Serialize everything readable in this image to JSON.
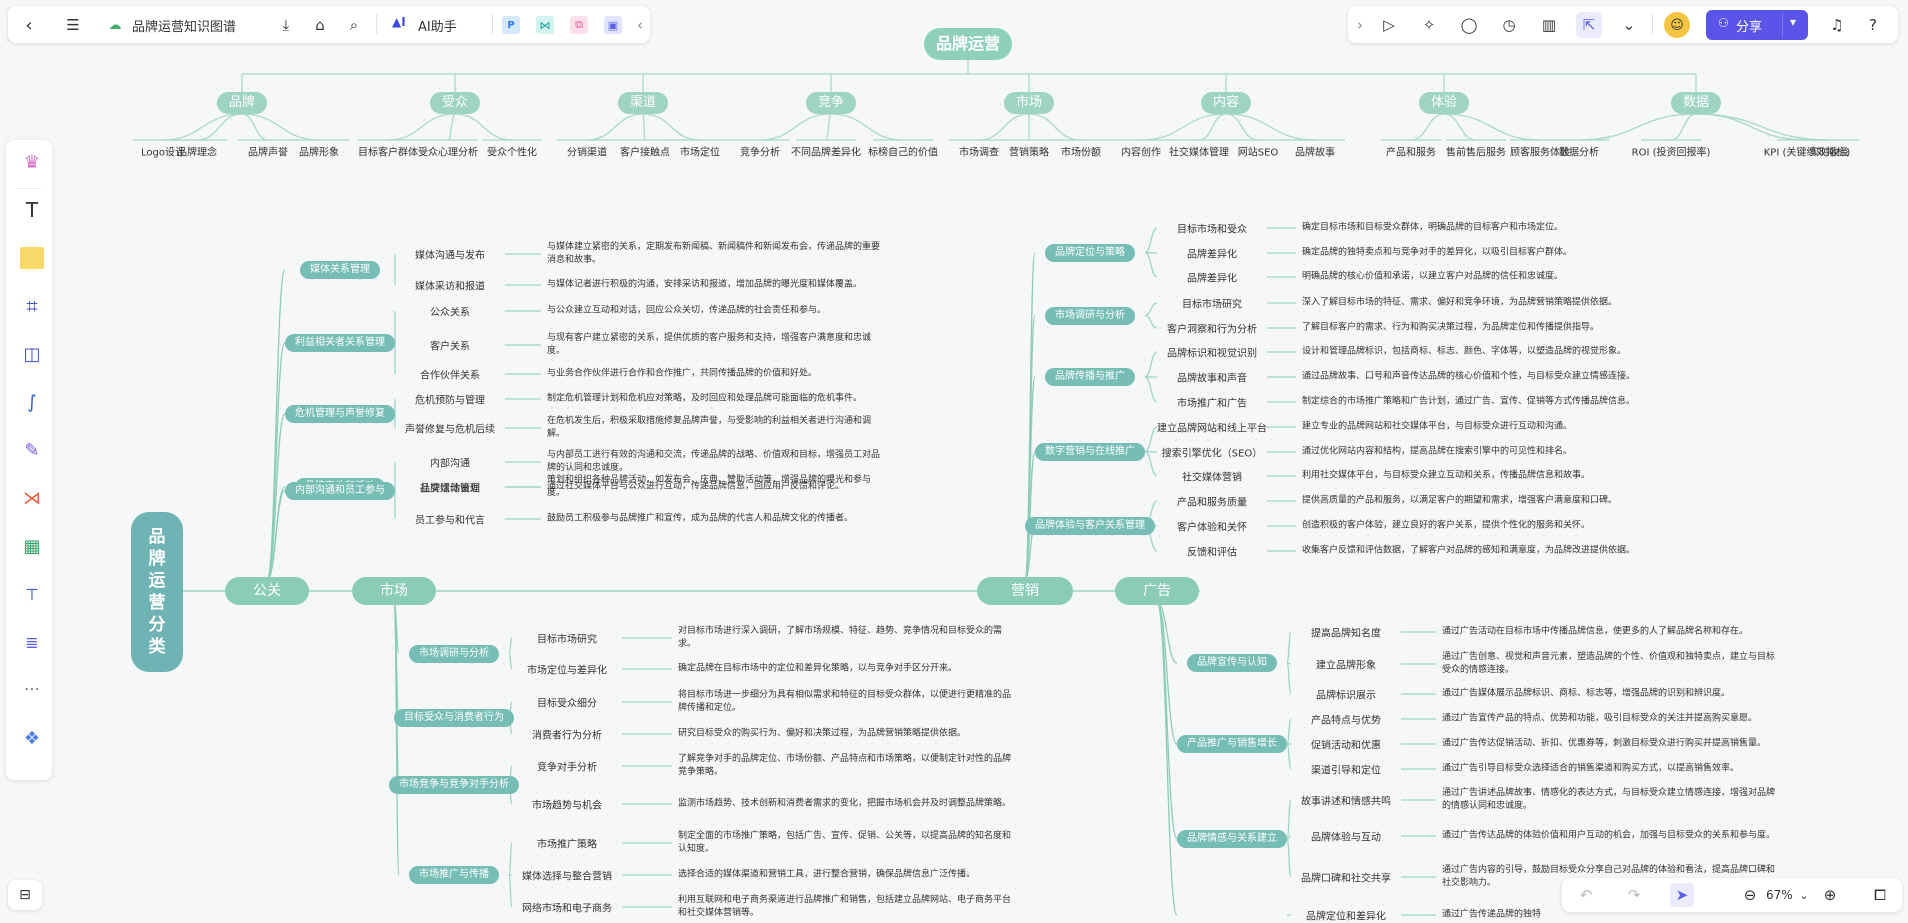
{
  "doc_title": "品牌运营知识图谱",
  "ai_label": "AI助手",
  "share_label": "分享",
  "zoom": "67%",
  "top_map": {
    "root": "品牌运营",
    "branches": [
      {
        "label": "品牌",
        "children": [
          "Logo设计",
          "品牌理念",
          "品牌声誉",
          "品牌形象"
        ]
      },
      {
        "label": "受众",
        "children": [
          "目标客户群体",
          "受众心理分析",
          "受众个性化"
        ]
      },
      {
        "label": "渠道",
        "children": [
          "分销渠道",
          "客户接触点",
          "市场定位"
        ]
      },
      {
        "label": "竞争",
        "children": [
          "竞争分析",
          "不同品牌差异化",
          "标榜自己的价值"
        ]
      },
      {
        "label": "市场",
        "children": [
          "市场调查",
          "营销策略",
          "市场份额"
        ]
      },
      {
        "label": "内容",
        "children": [
          "内容创作",
          "社交媒体管理",
          "网站SEO",
          "品牌故事"
        ]
      },
      {
        "label": "体验",
        "children": [
          "产品和服务",
          "售前售后服务",
          "顾客服务体验"
        ]
      },
      {
        "label": "数据",
        "children": [
          "数据分析",
          "ROI (投资回报率)",
          "KPI (关键绩效指标)",
          "实时收益"
        ]
      }
    ]
  },
  "main_map": {
    "root": "品牌运营分类",
    "main_nodes": [
      "公关",
      "市场",
      "营销",
      "广告"
    ],
    "pr": [
      {
        "label": "媒体关系管理",
        "items": [
          {
            "name": "媒体沟通与发布",
            "desc": "与媒体建立紧密的关系，定期发布新闻稿、新闻稿件和新闻发布会，传递品牌的重要消息和故事。"
          },
          {
            "name": "媒体采访和报道",
            "desc": "与媒体记者进行积极的沟通，安排采访和报道，增加品牌的曝光度和媒体覆盖。"
          }
        ]
      },
      {
        "label": "利益相关者关系管理",
        "items": [
          {
            "name": "公众关系",
            "desc": "与公众建立互动和对话，回应公众关切，传递品牌的社会责任和参与。"
          },
          {
            "name": "客户关系",
            "desc": "与现有客户建立紧密的关系，提供优质的客户服务和支持，增强客户满意度和忠诚度。"
          },
          {
            "name": "合作伙伴关系",
            "desc": "与业务合作伙伴进行合作和合作推广，共同传播品牌的价值和好处。"
          }
        ]
      },
      {
        "label": "危机管理与声誉修复",
        "items": [
          {
            "name": "危机预防与管理",
            "desc": "制定危机管理计划和危机应对策略，及时回应和处理品牌可能面临的危机事件。"
          },
          {
            "name": "声誉修复与危机后续",
            "desc": "在危机发生后，积极采取措施修复品牌声誉，与受影响的利益相关者进行沟通和调解。"
          }
        ]
      },
      {
        "label": "品牌事件和活动",
        "items": [
          {
            "name": "品牌活动策划",
            "desc": "策划和组织各种品牌活动，如发布会、庆典、赞助活动等，增强品牌的曝光和参与度。"
          },
          {
            "name": "社交媒体管理",
            "desc": "通过社交媒体平台与公众进行互动，传递品牌信息，回应用户反馈和评论。"
          }
        ]
      },
      {
        "label": "内部沟通和员工参与",
        "items": [
          {
            "name": "内部沟通",
            "desc": "与内部员工进行有效的沟通和交流，传递品牌的战略、价值观和目标，增强员工对品牌的认同和忠诚度。"
          },
          {
            "name": "员工参与和代言",
            "desc": "鼓励员工积极参与品牌推广和宣传，成为品牌的代言人和品牌文化的传播者。"
          }
        ]
      }
    ],
    "market": [
      {
        "label": "市场调研与分析",
        "items": [
          {
            "name": "目标市场研究",
            "desc": "对目标市场进行深入调研，了解市场规模、特征、趋势、竞争情况和目标受众的需求。"
          },
          {
            "name": "市场定位与差异化",
            "desc": "确定品牌在目标市场中的定位和差异化策略，以与竞争对手区分开来。"
          }
        ]
      },
      {
        "label": "目标受众与消费者行为",
        "items": [
          {
            "name": "目标受众细分",
            "desc": "将目标市场进一步细分为具有相似需求和特征的目标受众群体，以便进行更精准的品牌传播和定位。"
          },
          {
            "name": "消费者行为分析",
            "desc": "研究目标受众的购买行为、偏好和决策过程，为品牌营销策略提供依据。"
          }
        ]
      },
      {
        "label": "市场竞争与竞争对手分析",
        "items": [
          {
            "name": "竞争对手分析",
            "desc": "了解竞争对手的品牌定位、市场份额、产品特点和市场策略，以便制定针对性的品牌竞争策略。"
          },
          {
            "name": "市场趋势与机会",
            "desc": "监测市场趋势、技术创新和消费者需求的变化，把握市场机会并及时调整品牌策略。"
          }
        ]
      },
      {
        "label": "市场推广与传播",
        "items": [
          {
            "name": "市场推广策略",
            "desc": "制定全面的市场推广策略，包括广告、宣传、促销、公关等，以提高品牌的知名度和认知度。"
          },
          {
            "name": "媒体选择与整合营销",
            "desc": "选择合适的媒体渠道和营销工具，进行整合营销，确保品牌信息广泛传播。"
          },
          {
            "name": "网络市场和电子商务",
            "desc": "利用互联网和电子商务渠道进行品牌推广和销售，包括建立品牌网站、电子商务平台和社交媒体营销等。"
          }
        ]
      }
    ],
    "marketing": [
      {
        "label": "品牌定位与策略",
        "items": [
          {
            "name": "目标市场和受众",
            "desc": "确定目标市场和目标受众群体，明确品牌的目标客户和市场定位。"
          },
          {
            "name": "品牌差异化",
            "desc": "确定品牌的独特卖点和与竞争对手的差异化，以吸引目标客户群体。"
          },
          {
            "name": "品牌差异化",
            "desc": "明确品牌的核心价值和承诺，以建立客户对品牌的信任和忠诚度。"
          }
        ]
      },
      {
        "label": "市场调研与分析",
        "items": [
          {
            "name": "目标市场研究",
            "desc": "深入了解目标市场的特征、需求、偏好和竞争环境，为品牌营销策略提供依据。"
          },
          {
            "name": "客户洞察和行为分析",
            "desc": "了解目标客户的需求、行为和购买决策过程，为品牌定位和传播提供指导。"
          }
        ]
      },
      {
        "label": "品牌传播与推广",
        "items": [
          {
            "name": "品牌标识和视觉识别",
            "desc": "设计和管理品牌标识，包括商标、标志、颜色、字体等，以塑造品牌的视觉形象。"
          },
          {
            "name": "品牌故事和声音",
            "desc": "通过品牌故事、口号和声音传达品牌的核心价值和个性，与目标受众建立情感连接。"
          },
          {
            "name": "市场推广和广告",
            "desc": "制定综合的市场推广策略和广告计划，通过广告、宣传、促销等方式传播品牌信息。"
          }
        ]
      },
      {
        "label": "数字营销与在线推广",
        "items": [
          {
            "name": "建立品牌网站和线上平台",
            "desc": "建立专业的品牌网站和社交媒体平台，与目标受众进行互动和沟通。"
          },
          {
            "name": "搜索引擎优化（SEO）",
            "desc": "通过优化网站内容和结构，提高品牌在搜索引擎中的可见性和排名。"
          },
          {
            "name": "社交媒体营销",
            "desc": "利用社交媒体平台，与目标受众建立互动和关系，传播品牌信息和故事。"
          }
        ]
      },
      {
        "label": "品牌体验与客户关系管理",
        "items": [
          {
            "name": "产品和服务质量",
            "desc": "提供高质量的产品和服务，以满足客户的期望和需求，增强客户满意度和口碑。"
          },
          {
            "name": "客户体验和关怀",
            "desc": "创造积极的客户体验，建立良好的客户关系，提供个性化的服务和关怀。"
          },
          {
            "name": "反馈和评估",
            "desc": "收集客户反馈和评估数据，了解客户对品牌的感知和满意度，为品牌改进提供依据。"
          }
        ]
      }
    ],
    "ads": [
      {
        "label": "品牌宣传与认知",
        "items": [
          {
            "name": "提高品牌知名度",
            "desc": "通过广告活动在目标市场中传播品牌信息，使更多的人了解品牌名称和存在。"
          },
          {
            "name": "建立品牌形象",
            "desc": "通过广告创意、视觉和声音元素，塑造品牌的个性、价值观和独特卖点，建立与目标受众的情感连接。"
          },
          {
            "name": "品牌标识展示",
            "desc": "通过广告媒体展示品牌标识、商标、标志等，增强品牌的识别和辨识度。"
          }
        ]
      },
      {
        "label": "产品推广与销售增长",
        "items": [
          {
            "name": "产品特点与优势",
            "desc": "通过广告宣传产品的特点、优势和功能，吸引目标受众的关注并提高购买意愿。"
          },
          {
            "name": "促销活动和优惠",
            "desc": "通过广告传达促销活动、折扣、优惠券等，刺激目标受众进行购买并提高销售量。"
          },
          {
            "name": "渠道引导和定位",
            "desc": "通过广告引导目标受众选择适合的销售渠道和购买方式，以提高销售效率。"
          }
        ]
      },
      {
        "label": "品牌情感与关系建立",
        "items": [
          {
            "name": "故事讲述和情感共鸣",
            "desc": "通过广告讲述品牌故事、情感化的表达方式，与目标受众建立情感连接，增强对品牌的情感认同和忠诚度。"
          },
          {
            "name": "品牌体验与互动",
            "desc": "通过广告传达品牌的体验价值和用户互动的机会，加强与目标受众的关系和参与度。"
          },
          {
            "name": "品牌口碑和社交共享",
            "desc": "通过广告内容的引导，鼓励目标受众分享自己对品牌的体验和看法，提高品牌口碑和社交影响力。"
          }
        ]
      },
      {
        "label": "",
        "items": [
          {
            "name": "品牌定位和差异化",
            "desc": "通过广告传递品牌的独特"
          }
        ]
      }
    ]
  }
}
